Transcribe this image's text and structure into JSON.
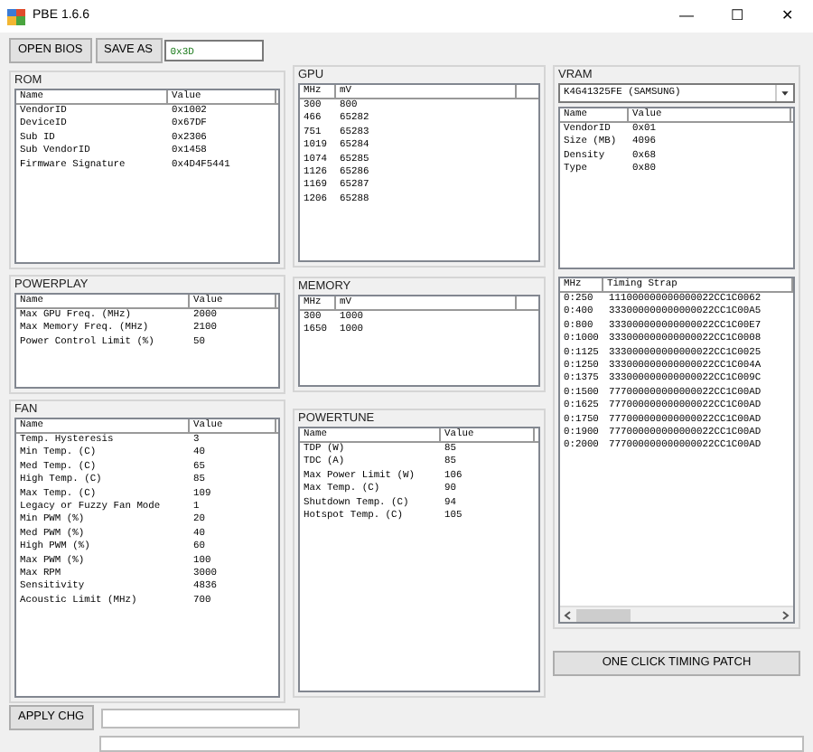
{
  "window": {
    "title": "PBE 1.6.6",
    "controls": [
      "—",
      "☐",
      "✕"
    ]
  },
  "toolbar": {
    "open_button": "OPEN BIOS",
    "save_button": "SAVE AS",
    "field_value": "0x3D"
  },
  "rom": {
    "title": "ROM",
    "columns": [
      "Name",
      "Value"
    ],
    "rows": [
      [
        "VendorID",
        "0x1002"
      ],
      [
        "DeviceID",
        "0x67DF"
      ],
      [
        "Sub ID",
        "0x2306"
      ],
      [
        "Sub VendorID",
        "0x1458"
      ],
      [
        "Firmware Signature",
        "0x4D4F5441"
      ]
    ]
  },
  "powerplay": {
    "title": "POWERPLAY",
    "columns": [
      "Name",
      "Value"
    ],
    "rows": [
      [
        "Max GPU Freq. (MHz)",
        "2000"
      ],
      [
        "Max Memory Freq. (MHz)",
        "2100"
      ],
      [
        "Power Control Limit (%)",
        "50"
      ]
    ]
  },
  "fan": {
    "title": "FAN",
    "columns": [
      "Name",
      "Value"
    ],
    "rows": [
      [
        "Temp. Hysteresis",
        "3"
      ],
      [
        "Min Temp. (C)",
        "40"
      ],
      [
        "Med Temp. (C)",
        "65"
      ],
      [
        "High Temp. (C)",
        "85"
      ],
      [
        "Max Temp. (C)",
        "109"
      ],
      [
        "Legacy or Fuzzy Fan Mode",
        "1"
      ],
      [
        "Min PWM (%)",
        "20"
      ],
      [
        "Med PWM (%)",
        "40"
      ],
      [
        "High PWM (%)",
        "60"
      ],
      [
        "Max PWM (%)",
        "100"
      ],
      [
        "Max RPM",
        "3000"
      ],
      [
        "Sensitivity",
        "4836"
      ],
      [
        "Acoustic Limit (MHz)",
        "700"
      ]
    ]
  },
  "gpu": {
    "title": "GPU",
    "columns": [
      "MHz",
      "mV"
    ],
    "rows": [
      [
        "300",
        "800"
      ],
      [
        "466",
        "65282"
      ],
      [
        "751",
        "65283"
      ],
      [
        "1019",
        "65284"
      ],
      [
        "1074",
        "65285"
      ],
      [
        "1126",
        "65286"
      ],
      [
        "1169",
        "65287"
      ],
      [
        "1206",
        "65288"
      ]
    ]
  },
  "memory": {
    "title": "MEMORY",
    "columns": [
      "MHz",
      "mV"
    ],
    "rows": [
      [
        "300",
        "1000"
      ],
      [
        "1650",
        "1000"
      ]
    ]
  },
  "powertune": {
    "title": "POWERTUNE",
    "columns": [
      "Name",
      "Value"
    ],
    "rows": [
      [
        "TDP (W)",
        "85"
      ],
      [
        "TDC (A)",
        "85"
      ],
      [
        "Max Power Limit (W)",
        "106"
      ],
      [
        "Max Temp. (C)",
        "90"
      ],
      [
        "Shutdown Temp. (C)",
        "94"
      ],
      [
        "Hotspot Temp. (C)",
        "105"
      ]
    ]
  },
  "vram": {
    "title": "VRAM",
    "dropdown": "K4G41325FE (SAMSUNG)",
    "columns": [
      "Name",
      "Value"
    ],
    "rows": [
      [
        "VendorID",
        "0x01"
      ],
      [
        "Size (MB)",
        "4096"
      ],
      [
        "Density",
        "0x68"
      ],
      [
        "Type",
        "0x80"
      ]
    ]
  },
  "timings": {
    "columns": [
      "MHz",
      "Timing Strap"
    ],
    "rows": [
      [
        "0:250",
        "111000000000000022CC1C0062"
      ],
      [
        "0:400",
        "333000000000000022CC1C00A5"
      ],
      [
        "0:800",
        "333000000000000022CC1C00E7"
      ],
      [
        "0:1000",
        "333000000000000022CC1C0008"
      ],
      [
        "0:1125",
        "333000000000000022CC1C0025"
      ],
      [
        "0:1250",
        "333000000000000022CC1C004A"
      ],
      [
        "0:1375",
        "333000000000000022CC1C009C"
      ],
      [
        "0:1500",
        "777000000000000022CC1C00AD"
      ],
      [
        "0:1625",
        "777000000000000022CC1C00AD"
      ],
      [
        "0:1750",
        "777000000000000022CC1C00AD"
      ],
      [
        "0:1900",
        "777000000000000022CC1C00AD"
      ],
      [
        "0:2000",
        "777000000000000022CC1C00AD"
      ]
    ]
  },
  "patch_button": "ONE CLICK TIMING PATCH",
  "apply_button": "APPLY CHG"
}
